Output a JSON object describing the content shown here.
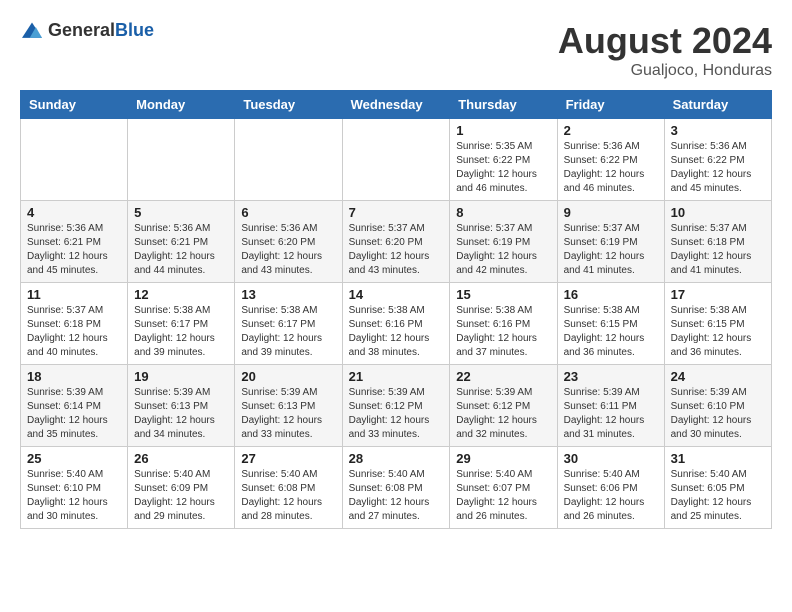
{
  "logo": {
    "general": "General",
    "blue": "Blue"
  },
  "title": {
    "month_year": "August 2024",
    "location": "Gualjoco, Honduras"
  },
  "weekdays": [
    "Sunday",
    "Monday",
    "Tuesday",
    "Wednesday",
    "Thursday",
    "Friday",
    "Saturday"
  ],
  "weeks": [
    [
      {
        "day": "",
        "info": ""
      },
      {
        "day": "",
        "info": ""
      },
      {
        "day": "",
        "info": ""
      },
      {
        "day": "",
        "info": ""
      },
      {
        "day": "1",
        "info": "Sunrise: 5:35 AM\nSunset: 6:22 PM\nDaylight: 12 hours\nand 46 minutes."
      },
      {
        "day": "2",
        "info": "Sunrise: 5:36 AM\nSunset: 6:22 PM\nDaylight: 12 hours\nand 46 minutes."
      },
      {
        "day": "3",
        "info": "Sunrise: 5:36 AM\nSunset: 6:22 PM\nDaylight: 12 hours\nand 45 minutes."
      }
    ],
    [
      {
        "day": "4",
        "info": "Sunrise: 5:36 AM\nSunset: 6:21 PM\nDaylight: 12 hours\nand 45 minutes."
      },
      {
        "day": "5",
        "info": "Sunrise: 5:36 AM\nSunset: 6:21 PM\nDaylight: 12 hours\nand 44 minutes."
      },
      {
        "day": "6",
        "info": "Sunrise: 5:36 AM\nSunset: 6:20 PM\nDaylight: 12 hours\nand 43 minutes."
      },
      {
        "day": "7",
        "info": "Sunrise: 5:37 AM\nSunset: 6:20 PM\nDaylight: 12 hours\nand 43 minutes."
      },
      {
        "day": "8",
        "info": "Sunrise: 5:37 AM\nSunset: 6:19 PM\nDaylight: 12 hours\nand 42 minutes."
      },
      {
        "day": "9",
        "info": "Sunrise: 5:37 AM\nSunset: 6:19 PM\nDaylight: 12 hours\nand 41 minutes."
      },
      {
        "day": "10",
        "info": "Sunrise: 5:37 AM\nSunset: 6:18 PM\nDaylight: 12 hours\nand 41 minutes."
      }
    ],
    [
      {
        "day": "11",
        "info": "Sunrise: 5:37 AM\nSunset: 6:18 PM\nDaylight: 12 hours\nand 40 minutes."
      },
      {
        "day": "12",
        "info": "Sunrise: 5:38 AM\nSunset: 6:17 PM\nDaylight: 12 hours\nand 39 minutes."
      },
      {
        "day": "13",
        "info": "Sunrise: 5:38 AM\nSunset: 6:17 PM\nDaylight: 12 hours\nand 39 minutes."
      },
      {
        "day": "14",
        "info": "Sunrise: 5:38 AM\nSunset: 6:16 PM\nDaylight: 12 hours\nand 38 minutes."
      },
      {
        "day": "15",
        "info": "Sunrise: 5:38 AM\nSunset: 6:16 PM\nDaylight: 12 hours\nand 37 minutes."
      },
      {
        "day": "16",
        "info": "Sunrise: 5:38 AM\nSunset: 6:15 PM\nDaylight: 12 hours\nand 36 minutes."
      },
      {
        "day": "17",
        "info": "Sunrise: 5:38 AM\nSunset: 6:15 PM\nDaylight: 12 hours\nand 36 minutes."
      }
    ],
    [
      {
        "day": "18",
        "info": "Sunrise: 5:39 AM\nSunset: 6:14 PM\nDaylight: 12 hours\nand 35 minutes."
      },
      {
        "day": "19",
        "info": "Sunrise: 5:39 AM\nSunset: 6:13 PM\nDaylight: 12 hours\nand 34 minutes."
      },
      {
        "day": "20",
        "info": "Sunrise: 5:39 AM\nSunset: 6:13 PM\nDaylight: 12 hours\nand 33 minutes."
      },
      {
        "day": "21",
        "info": "Sunrise: 5:39 AM\nSunset: 6:12 PM\nDaylight: 12 hours\nand 33 minutes."
      },
      {
        "day": "22",
        "info": "Sunrise: 5:39 AM\nSunset: 6:12 PM\nDaylight: 12 hours\nand 32 minutes."
      },
      {
        "day": "23",
        "info": "Sunrise: 5:39 AM\nSunset: 6:11 PM\nDaylight: 12 hours\nand 31 minutes."
      },
      {
        "day": "24",
        "info": "Sunrise: 5:39 AM\nSunset: 6:10 PM\nDaylight: 12 hours\nand 30 minutes."
      }
    ],
    [
      {
        "day": "25",
        "info": "Sunrise: 5:40 AM\nSunset: 6:10 PM\nDaylight: 12 hours\nand 30 minutes."
      },
      {
        "day": "26",
        "info": "Sunrise: 5:40 AM\nSunset: 6:09 PM\nDaylight: 12 hours\nand 29 minutes."
      },
      {
        "day": "27",
        "info": "Sunrise: 5:40 AM\nSunset: 6:08 PM\nDaylight: 12 hours\nand 28 minutes."
      },
      {
        "day": "28",
        "info": "Sunrise: 5:40 AM\nSunset: 6:08 PM\nDaylight: 12 hours\nand 27 minutes."
      },
      {
        "day": "29",
        "info": "Sunrise: 5:40 AM\nSunset: 6:07 PM\nDaylight: 12 hours\nand 26 minutes."
      },
      {
        "day": "30",
        "info": "Sunrise: 5:40 AM\nSunset: 6:06 PM\nDaylight: 12 hours\nand 26 minutes."
      },
      {
        "day": "31",
        "info": "Sunrise: 5:40 AM\nSunset: 6:05 PM\nDaylight: 12 hours\nand 25 minutes."
      }
    ]
  ]
}
